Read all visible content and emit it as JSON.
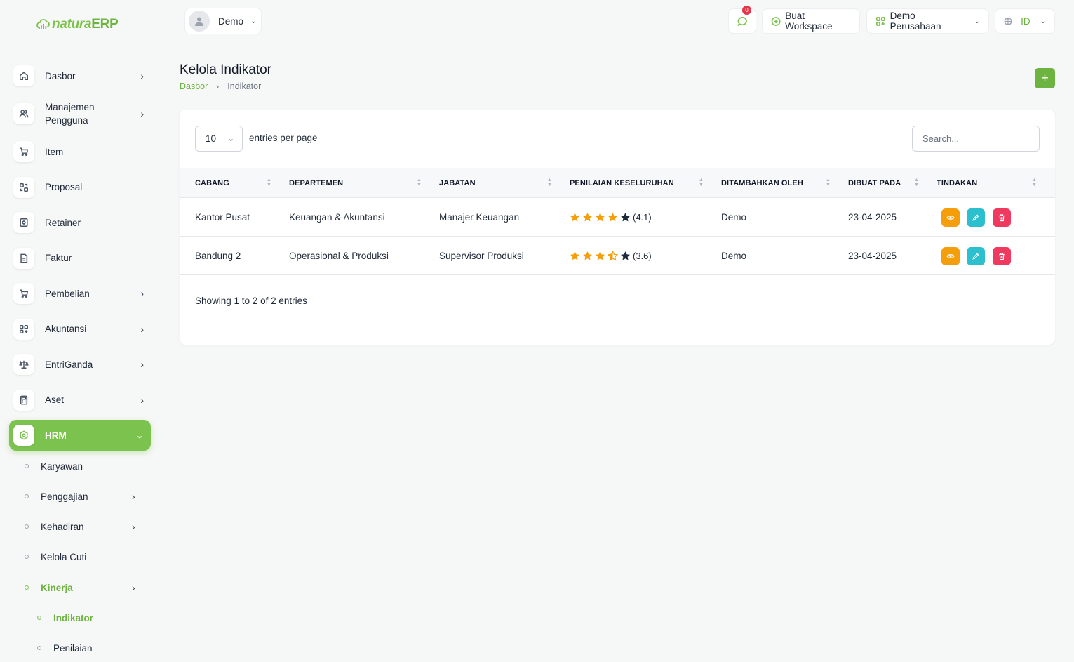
{
  "app": {
    "logo_part1": "natura",
    "logo_part2": "ERP"
  },
  "topbar": {
    "user_name": "Demo",
    "notification_count": "0",
    "create_workspace": "Buat Workspace",
    "company": "Demo Perusahaan",
    "language": "ID"
  },
  "sidebar": {
    "items": [
      {
        "label": "Dasbor",
        "icon": "home-icon",
        "chevron": "›"
      },
      {
        "label": "Manajemen Pengguna",
        "icon": "users-icon",
        "chevron": "›"
      },
      {
        "label": "Item",
        "icon": "cart-icon",
        "chevron": ""
      },
      {
        "label": "Proposal",
        "icon": "swap-icon",
        "chevron": ""
      },
      {
        "label": "Retainer",
        "icon": "retainer-icon",
        "chevron": ""
      },
      {
        "label": "Faktur",
        "icon": "invoice-icon",
        "chevron": ""
      },
      {
        "label": "Pembelian",
        "icon": "cart-icon",
        "chevron": "›"
      },
      {
        "label": "Akuntansi",
        "icon": "grid-icon",
        "chevron": "›"
      },
      {
        "label": "EntriGanda",
        "icon": "scale-icon",
        "chevron": "›"
      },
      {
        "label": "Aset",
        "icon": "calculator-icon",
        "chevron": "›"
      },
      {
        "label": "HRM",
        "icon": "hrm-icon",
        "chevron": "⌄"
      }
    ],
    "sub_items": [
      {
        "label": "Karyawan",
        "chevron": ""
      },
      {
        "label": "Penggajian",
        "chevron": "›"
      },
      {
        "label": "Kehadiran",
        "chevron": "›"
      },
      {
        "label": "Kelola Cuti",
        "chevron": ""
      },
      {
        "label": "Kinerja",
        "chevron": "›"
      },
      {
        "label": "Indikator",
        "chevron": ""
      },
      {
        "label": "Penilaian",
        "chevron": ""
      }
    ]
  },
  "page": {
    "title": "Kelola Indikator",
    "breadcrumb_home": "Dasbor",
    "breadcrumb_sep": "›",
    "breadcrumb_current": "Indikator",
    "add_button": "+"
  },
  "table": {
    "per_page_value": "10",
    "per_page_label": "entries per page",
    "search_placeholder": "Search...",
    "columns": [
      "CABANG",
      "DEPARTEMEN",
      "JABATAN",
      "PENILAIAN KESELURUHAN",
      "DITAMBAHKAN OLEH",
      "DIBUAT PADA",
      "TINDAKAN"
    ],
    "rows": [
      {
        "cabang": "Kantor Pusat",
        "departemen": "Keuangan & Akuntansi",
        "jabatan": "Manajer Keuangan",
        "rating": 4.1,
        "rating_text": "(4.1)",
        "ditambahkan_oleh": "Demo",
        "dibuat_pada": "23-04-2025"
      },
      {
        "cabang": "Bandung 2",
        "departemen": "Operasional & Produksi",
        "jabatan": "Supervisor Produksi",
        "rating": 3.6,
        "rating_text": "(3.6)",
        "ditambahkan_oleh": "Demo",
        "dibuat_pada": "23-04-2025"
      }
    ],
    "footer": "Showing 1 to 2 of 2 entries"
  },
  "colors": {
    "brand_green": "#7cc24f",
    "star_filled": "#f59e0b",
    "star_empty": "#1f2937",
    "view_button": "#f59e0b",
    "edit_button": "#2cc0cf",
    "delete_button": "#f0395e"
  }
}
